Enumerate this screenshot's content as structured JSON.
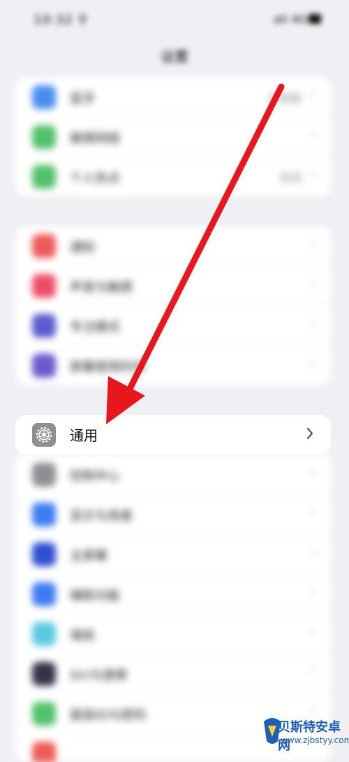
{
  "status_bar": {
    "time": "10:32 ⚲",
    "signal": "atl 4G"
  },
  "nav": {
    "title": "设置"
  },
  "group1": [
    {
      "label": "蓝牙",
      "value": "未连接",
      "color": "#4a8df0"
    },
    {
      "label": "蜂窝网络",
      "value": "",
      "color": "#53c26b"
    },
    {
      "label": "个人热点",
      "value": "关闭",
      "color": "#53c26b"
    }
  ],
  "group2": [
    {
      "label": "通知",
      "value": "",
      "color": "#ee5a57"
    },
    {
      "label": "声音与触感",
      "value": "",
      "color": "#ee4d6a"
    },
    {
      "label": "专注模式",
      "value": "",
      "color": "#5b5ccd"
    },
    {
      "label": "屏幕使用时间",
      "value": "",
      "color": "#6a5acd"
    }
  ],
  "general_row": {
    "label": "通用"
  },
  "group3": [
    {
      "label": "控制中心",
      "color": "#8e8e93"
    },
    {
      "label": "显示与亮度",
      "color": "#3d7cf0"
    },
    {
      "label": "主屏幕",
      "color": "#2e4fd0"
    },
    {
      "label": "辅助功能",
      "color": "#3d7cf0"
    },
    {
      "label": "墙纸",
      "color": "#5ac8e0"
    },
    {
      "label": "Siri与搜索",
      "color": "#333348"
    },
    {
      "label": "面容ID与密码",
      "color": "#53c26b"
    },
    {
      "label": "",
      "color": "#ee5a57"
    }
  ],
  "watermark": {
    "name": "贝斯特安卓网",
    "url": "www.zjbstyy.com"
  },
  "colors": {
    "arrow": "#e8171d",
    "background": "#efeff4"
  }
}
